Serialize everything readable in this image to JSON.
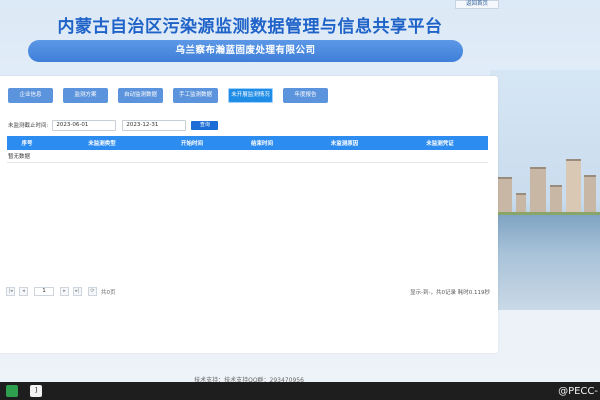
{
  "header": {
    "title": "内蒙古自治区污染源监测数据管理与信息共享平台",
    "back_home": "返回首页",
    "company": "乌兰察布瀚蓝固废处理有限公司"
  },
  "tabs": [
    {
      "label": "企业信息",
      "active": false
    },
    {
      "label": "监测方案",
      "active": false
    },
    {
      "label": "自动监测数据",
      "active": false
    },
    {
      "label": "手工监测数据",
      "active": false
    },
    {
      "label": "未开展监测情况",
      "active": true
    },
    {
      "label": "年度报告",
      "active": false
    }
  ],
  "filter": {
    "label": "未监测截止时间:",
    "start_date": "2023-06-01",
    "end_date": "2023-12-31",
    "query_label": "查询"
  },
  "table": {
    "columns": [
      "序号",
      "未监测类型",
      "开始时间",
      "结束时间",
      "未监测原因",
      "未监测凭证"
    ],
    "empty_text": "暂无数据"
  },
  "pager": {
    "current_page": "1",
    "total_pages": "共0页",
    "info": "显示-到-，共0记录  耗时0.119秒"
  },
  "footer": {
    "support": "技术支持：技术支持QQ群：293470956"
  },
  "taskbar": {
    "app_glyph": "]",
    "watermark": "@PECC-"
  },
  "colors": {
    "title_blue": "#1f63c9",
    "tab_blue": "#5b93dc",
    "tab_active": "#1f8ce6",
    "table_header": "#2d8cf0"
  }
}
